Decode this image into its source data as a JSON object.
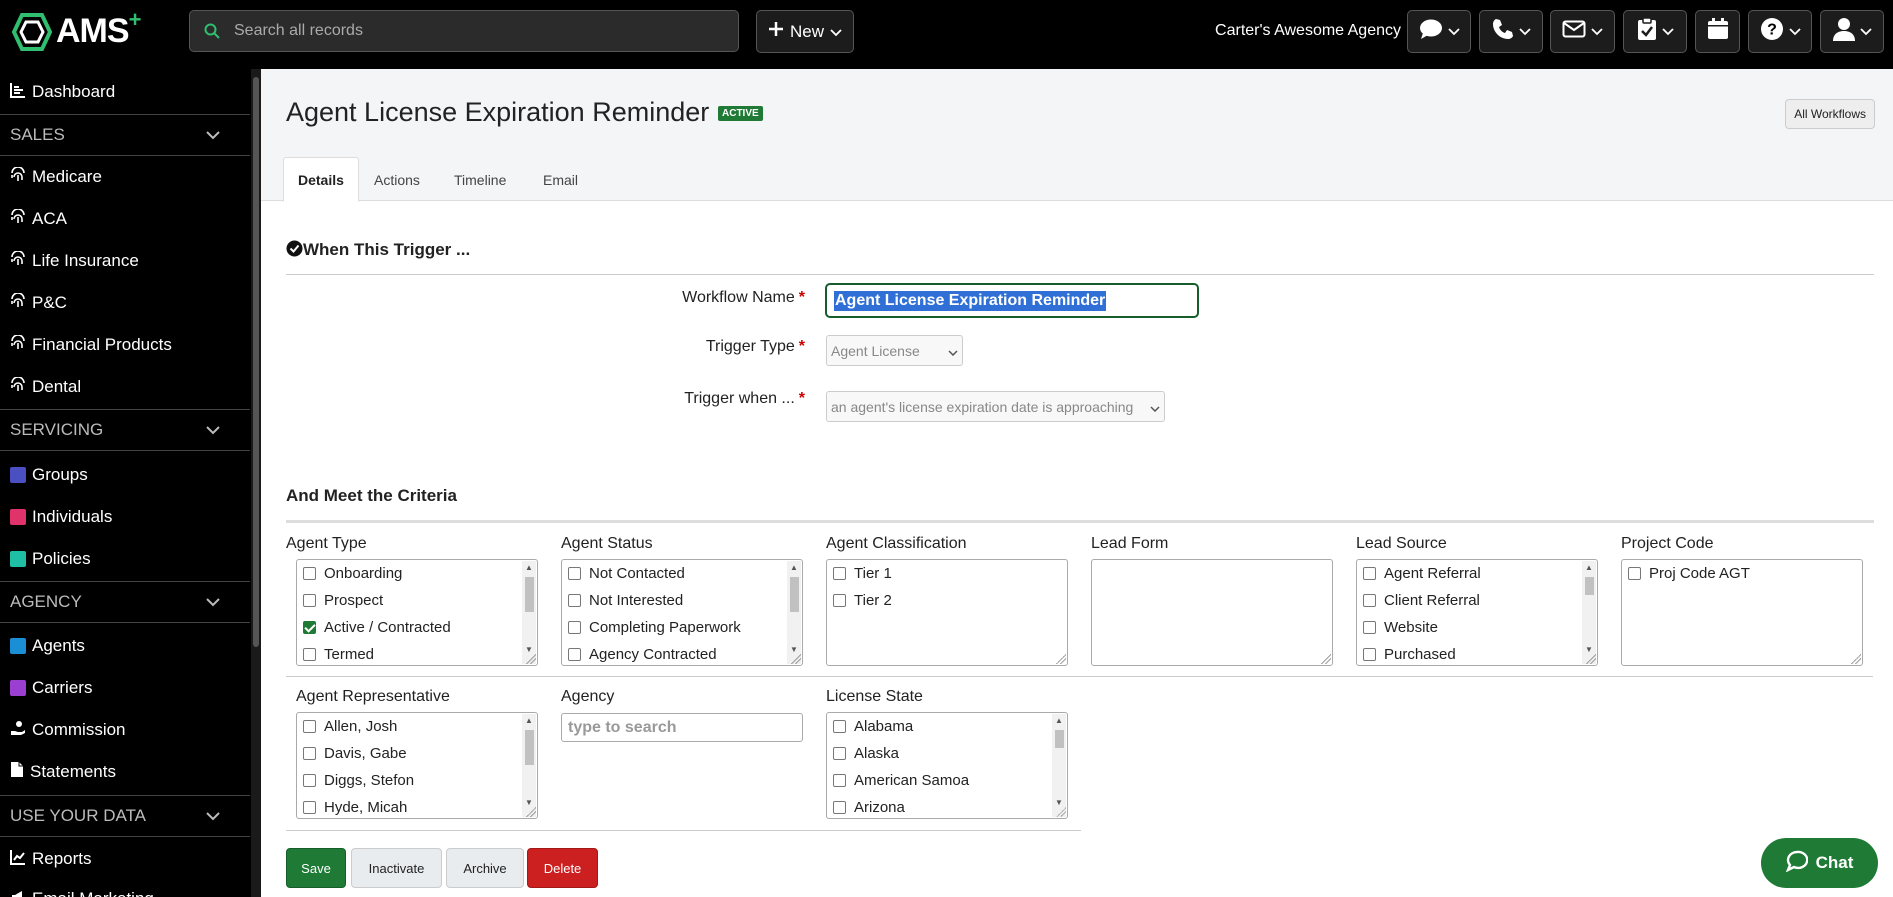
{
  "topbar": {
    "logo": {
      "text": "AMS",
      "plus": "+"
    },
    "search_placeholder": "Search all records",
    "new_label": "New",
    "agency_name": "Carter's Awesome Agency",
    "icons": [
      "chat-icon",
      "phone-icon",
      "mail-icon",
      "clipboard-icon",
      "calendar-icon",
      "help-icon",
      "user-icon"
    ]
  },
  "sidebar": {
    "dashboard": "Dashboard",
    "sales": {
      "title": "SALES",
      "items": [
        "Medicare",
        "ACA",
        "Life Insurance",
        "P&C",
        "Financial Products",
        "Dental"
      ]
    },
    "servicing": {
      "title": "SERVICING",
      "items": [
        {
          "label": "Groups",
          "color": "#4a4fc1"
        },
        {
          "label": "Individuals",
          "color": "#e0336b"
        },
        {
          "label": "Policies",
          "color": "#1fbfa5"
        }
      ]
    },
    "agency": {
      "title": "AGENCY",
      "items": [
        {
          "label": "Agents",
          "color": "#1a8fd6"
        },
        {
          "label": "Carriers",
          "color": "#9b3fd1"
        },
        {
          "label": "Commission"
        },
        {
          "label": "Statements"
        }
      ]
    },
    "use_your_data": {
      "title": "USE YOUR DATA",
      "items": [
        "Reports",
        "Email Marketing"
      ]
    }
  },
  "page": {
    "title": "Agent License Expiration Reminder",
    "status_badge": "ACTIVE",
    "all_workflows": "All Workflows",
    "tabs": [
      "Details",
      "Actions",
      "Timeline",
      "Email"
    ],
    "active_tab": "Details"
  },
  "trigger": {
    "heading": "When This Trigger ...",
    "workflow_name_label": "Workflow Name",
    "workflow_name_value": "Agent License Expiration Reminder",
    "trigger_type_label": "Trigger Type",
    "trigger_type_value": "Agent License",
    "trigger_when_label": "Trigger when ...",
    "trigger_when_value": "an agent's license expiration date is approaching"
  },
  "criteria": {
    "heading": "And Meet the Criteria",
    "agent_type": {
      "label": "Agent Type",
      "options": [
        {
          "label": "Onboarding",
          "checked": false
        },
        {
          "label": "Prospect",
          "checked": false
        },
        {
          "label": "Active / Contracted",
          "checked": true
        },
        {
          "label": "Termed",
          "checked": false
        }
      ]
    },
    "agent_status": {
      "label": "Agent Status",
      "options": [
        {
          "label": "Not Contacted",
          "checked": false
        },
        {
          "label": "Not Interested",
          "checked": false
        },
        {
          "label": "Completing Paperwork",
          "checked": false
        },
        {
          "label": "Agency Contracted",
          "checked": false
        }
      ]
    },
    "agent_classification": {
      "label": "Agent Classification",
      "options": [
        {
          "label": "Tier 1",
          "checked": false
        },
        {
          "label": "Tier 2",
          "checked": false
        }
      ]
    },
    "lead_form": {
      "label": "Lead Form",
      "options": []
    },
    "lead_source": {
      "label": "Lead Source",
      "options": [
        {
          "label": "Agent Referral",
          "checked": false
        },
        {
          "label": "Client Referral",
          "checked": false
        },
        {
          "label": "Website",
          "checked": false
        },
        {
          "label": "Purchased",
          "checked": false
        }
      ]
    },
    "project_code": {
      "label": "Project Code",
      "options": [
        {
          "label": "Proj Code AGT",
          "checked": false
        }
      ]
    },
    "agent_representative": {
      "label": "Agent Representative",
      "options": [
        {
          "label": "Allen, Josh",
          "checked": false
        },
        {
          "label": "Davis, Gabe",
          "checked": false
        },
        {
          "label": "Diggs, Stefon",
          "checked": false
        },
        {
          "label": "Hyde, Micah",
          "checked": false
        }
      ]
    },
    "agency": {
      "label": "Agency",
      "placeholder": "type to search"
    },
    "license_state": {
      "label": "License State",
      "options": [
        {
          "label": "Alabama",
          "checked": false
        },
        {
          "label": "Alaska",
          "checked": false
        },
        {
          "label": "American Samoa",
          "checked": false
        },
        {
          "label": "Arizona",
          "checked": false
        }
      ]
    }
  },
  "buttons": {
    "save": "Save",
    "inactivate": "Inactivate",
    "archive": "Archive",
    "delete": "Delete"
  },
  "chat": {
    "label": "Chat"
  },
  "colors": {
    "brand_green": "#1e7a34",
    "delete_red": "#cc1f1f",
    "selection_blue": "#2f6fd6"
  }
}
